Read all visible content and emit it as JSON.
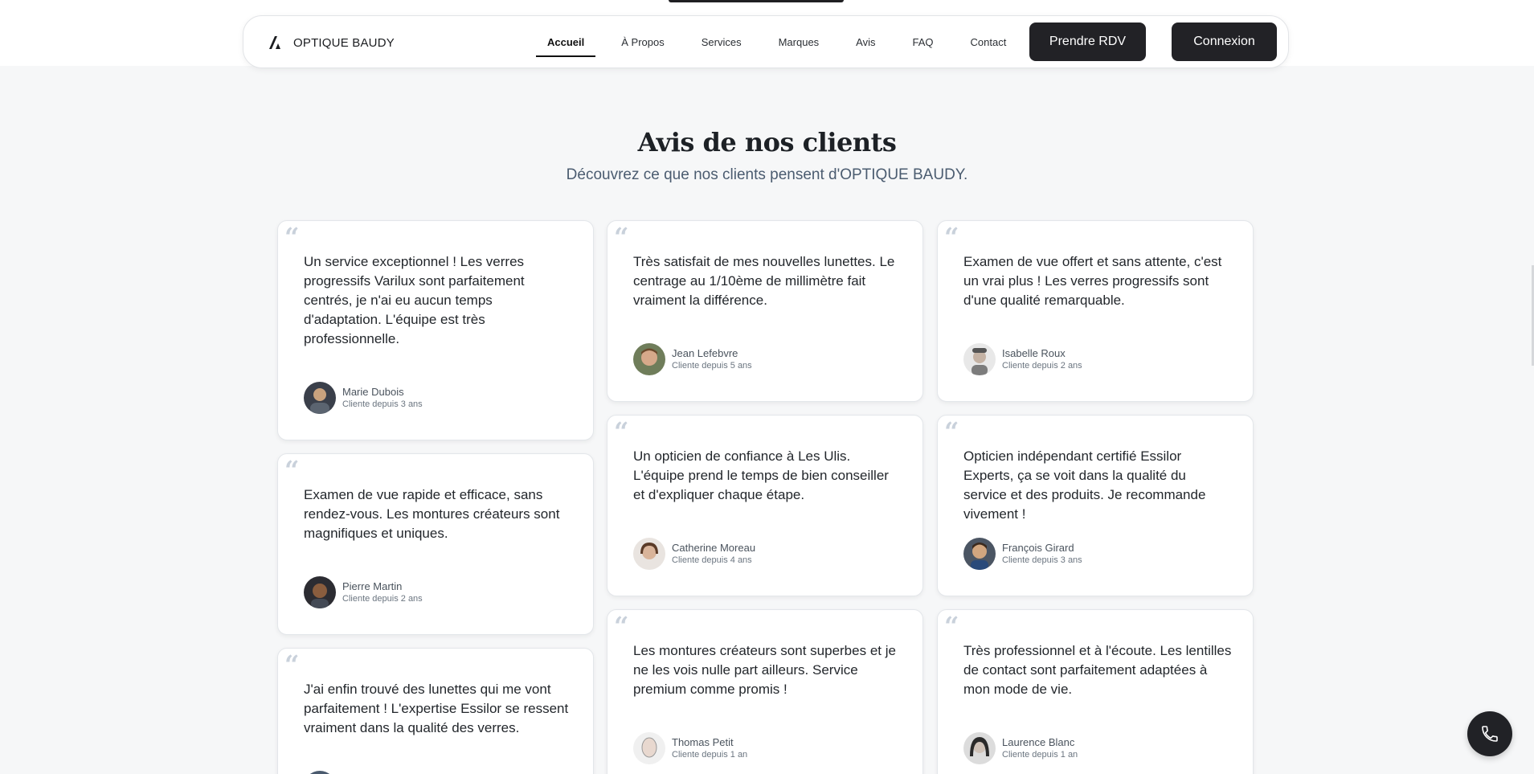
{
  "header": {
    "brand": "OPTIQUE BAUDY",
    "nav": [
      "Accueil",
      "À Propos",
      "Services",
      "Marques",
      "Avis",
      "FAQ",
      "Contact"
    ],
    "active_index": 0,
    "cta_label": "Prendre RDV",
    "login_label": "Connexion"
  },
  "section": {
    "title": "Avis de nos clients",
    "subtitle": "Découvrez ce que nos clients pensent d'OPTIQUE BAUDY."
  },
  "reviews": [
    {
      "text": "Un service exceptionnel ! Les verres progressifs Varilux sont parfaitement centrés, je n'ai eu aucun temps d'adaptation. L'équipe est très professionnelle.",
      "name": "Marie Dubois",
      "since": "Cliente depuis 3 ans"
    },
    {
      "text": "Très satisfait de mes nouvelles lunettes. Le centrage au 1/10ème de millimètre fait vraiment la différence.",
      "name": "Jean Lefebvre",
      "since": "Cliente depuis 5 ans"
    },
    {
      "text": "Examen de vue offert et sans attente, c'est un vrai plus ! Les verres progressifs sont d'une qualité remarquable.",
      "name": "Isabelle Roux",
      "since": "Cliente depuis 2 ans"
    },
    {
      "text": "Examen de vue rapide et efficace, sans rendez-vous. Les montures créateurs sont magnifiques et uniques.",
      "name": "Pierre Martin",
      "since": "Cliente depuis 2 ans"
    },
    {
      "text": "Un opticien de confiance à Les Ulis. L'équipe prend le temps de bien conseiller et d'expliquer chaque étape.",
      "name": "Catherine Moreau",
      "since": "Cliente depuis 4 ans"
    },
    {
      "text": "Opticien indépendant certifié Essilor Experts, ça se voit dans la qualité du service et des produits. Je recommande vivement !",
      "name": "François Girard",
      "since": "Cliente depuis 3 ans"
    },
    {
      "text": "J'ai enfin trouvé des lunettes qui me vont parfaitement ! L'expertise Essilor se ressent vraiment dans la qualité des verres.",
      "name": "",
      "since": ""
    },
    {
      "text": "Les montures créateurs sont superbes et je ne les vois nulle part ailleurs. Service premium comme promis !",
      "name": "Thomas Petit",
      "since": "Cliente depuis 1 an"
    },
    {
      "text": "Très professionnel et à l'écoute. Les lentilles de contact sont parfaitement adaptées à mon mode de vie.",
      "name": "Laurence Blanc",
      "since": "Cliente depuis 1 an"
    }
  ],
  "icons": {
    "brand": "optique-logo-icon",
    "quote": "quote-icon",
    "phone": "phone-icon"
  },
  "colors": {
    "dark": "#222226",
    "background": "#f6f7f8",
    "subtitle": "#4b5c70"
  }
}
